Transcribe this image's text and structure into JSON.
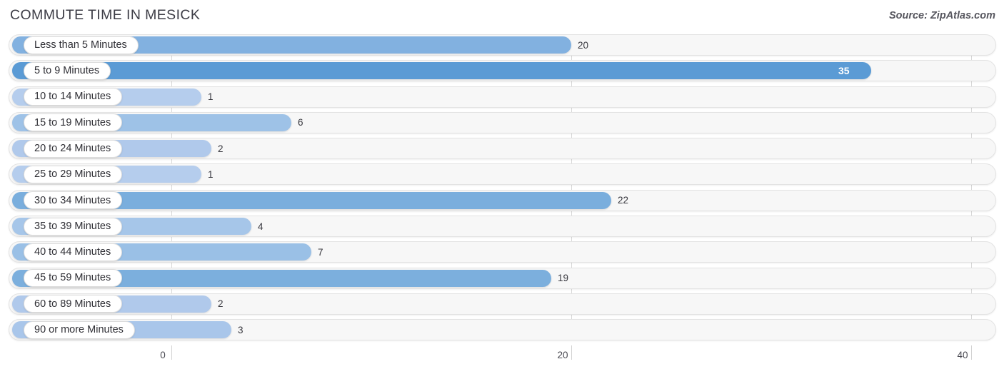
{
  "header": {
    "title": "COMMUTE TIME IN MESICK",
    "source": "Source: ZipAtlas.com"
  },
  "colors": {
    "bar_max": "#5b9bd5",
    "bar_high": "#6ca5da",
    "bar_mid": "#82b1e0",
    "bar_low": "#9ec2e7",
    "bar_min": "#b5cded",
    "track_bg": "#f7f7f7",
    "track_border": "#e3e3e3",
    "grid": "#d8d8d8",
    "title_text": "#3d3d46",
    "value_text": "#38383f",
    "value_text_inside": "#ffffff"
  },
  "chart_data": {
    "type": "bar",
    "orientation": "horizontal",
    "title": "COMMUTE TIME IN MESICK",
    "xlabel": "",
    "ylabel": "",
    "xlim": [
      0,
      40
    ],
    "xticks": [
      0,
      20,
      40
    ],
    "xticklabels": [
      "0",
      "20",
      "40"
    ],
    "grid": true,
    "legend": false,
    "categories": [
      "Less than 5 Minutes",
      "5 to 9 Minutes",
      "10 to 14 Minutes",
      "15 to 19 Minutes",
      "20 to 24 Minutes",
      "25 to 29 Minutes",
      "30 to 34 Minutes",
      "35 to 39 Minutes",
      "40 to 44 Minutes",
      "45 to 59 Minutes",
      "60 to 89 Minutes",
      "90 or more Minutes"
    ],
    "values": [
      20,
      35,
      1,
      6,
      2,
      1,
      22,
      4,
      7,
      19,
      2,
      3
    ],
    "value_labels": [
      "20",
      "35",
      "1",
      "6",
      "2",
      "1",
      "22",
      "4",
      "7",
      "19",
      "2",
      "3"
    ]
  },
  "rows": [
    {
      "label": "Less than 5 Minutes",
      "value": 20,
      "value_label": "20",
      "inside": false,
      "color": "#82b1e0"
    },
    {
      "label": "5 to 9 Minutes",
      "value": 35,
      "value_label": "35",
      "inside": true,
      "color": "#5b9bd5"
    },
    {
      "label": "10 to 14 Minutes",
      "value": 1,
      "value_label": "1",
      "inside": false,
      "color": "#b5cded"
    },
    {
      "label": "15 to 19 Minutes",
      "value": 6,
      "value_label": "6",
      "inside": false,
      "color": "#9ec2e7"
    },
    {
      "label": "20 to 24 Minutes",
      "value": 2,
      "value_label": "2",
      "inside": false,
      "color": "#b0c9eb"
    },
    {
      "label": "25 to 29 Minutes",
      "value": 1,
      "value_label": "1",
      "inside": false,
      "color": "#b5cded"
    },
    {
      "label": "30 to 34 Minutes",
      "value": 22,
      "value_label": "22",
      "inside": false,
      "color": "#7aaedd"
    },
    {
      "label": "35 to 39 Minutes",
      "value": 4,
      "value_label": "4",
      "inside": false,
      "color": "#a6c6e9"
    },
    {
      "label": "40 to 44 Minutes",
      "value": 7,
      "value_label": "7",
      "inside": false,
      "color": "#9ac0e6"
    },
    {
      "label": "45 to 59 Minutes",
      "value": 19,
      "value_label": "19",
      "inside": false,
      "color": "#7cafdd"
    },
    {
      "label": "60 to 89 Minutes",
      "value": 2,
      "value_label": "2",
      "inside": false,
      "color": "#b0c9eb"
    },
    {
      "label": "90 or more Minutes",
      "value": 3,
      "value_label": "3",
      "inside": false,
      "color": "#a9c6ea"
    }
  ],
  "axis": {
    "ticks": [
      {
        "label": "0",
        "value": 0
      },
      {
        "label": "20",
        "value": 20
      },
      {
        "label": "40",
        "value": 40
      }
    ]
  }
}
